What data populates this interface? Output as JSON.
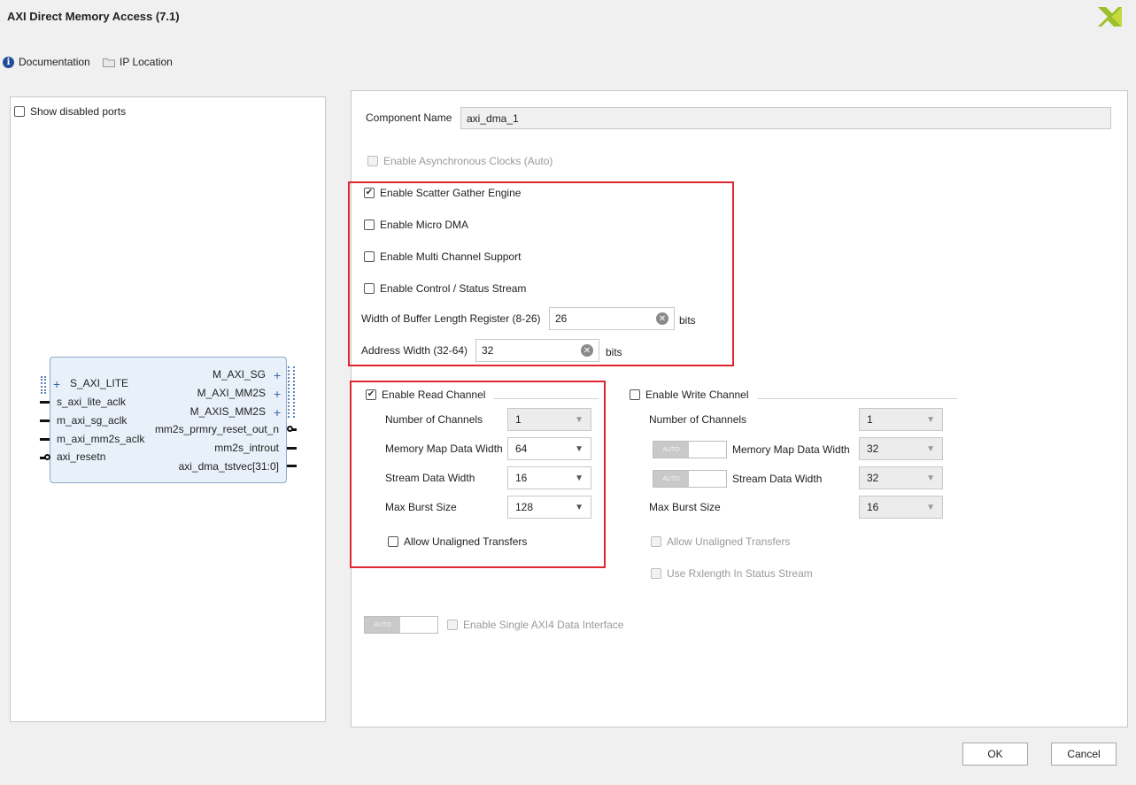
{
  "window": {
    "title": "AXI Direct Memory Access (7.1)"
  },
  "toolbar": {
    "documentation": "Documentation",
    "ip_location": "IP Location"
  },
  "left_panel": {
    "show_disabled_ports": "Show disabled ports",
    "ports_left": [
      "S_AXI_LITE",
      "s_axi_lite_aclk",
      "m_axi_sg_aclk",
      "m_axi_mm2s_aclk",
      "axi_resetn"
    ],
    "ports_right": [
      "M_AXI_SG",
      "M_AXI_MM2S",
      "M_AXIS_MM2S",
      "mm2s_prmry_reset_out_n",
      "mm2s_introut",
      "axi_dma_tstvec[31:0]"
    ]
  },
  "config": {
    "component_name_label": "Component Name",
    "component_name_value": "axi_dma_1",
    "enable_async_clocks": "Enable Asynchronous Clocks (Auto)",
    "enable_sg": "Enable Scatter Gather Engine",
    "enable_micro_dma": "Enable Micro DMA",
    "enable_multi_channel": "Enable Multi Channel Support",
    "enable_control_status": "Enable Control / Status Stream",
    "buffer_length_label": "Width of Buffer Length Register (8-26)",
    "buffer_length_value": "26",
    "address_width_label": "Address Width (32-64)",
    "address_width_value": "32",
    "bits": "bits"
  },
  "read_channel": {
    "title": "Enable Read Channel",
    "num_channels_label": "Number of Channels",
    "num_channels": "1",
    "mm_data_width_label": "Memory Map Data Width",
    "mm_data_width": "64",
    "stream_data_width_label": "Stream Data Width",
    "stream_data_width": "16",
    "max_burst_label": "Max Burst Size",
    "max_burst": "128",
    "allow_unaligned": "Allow Unaligned Transfers"
  },
  "write_channel": {
    "title": "Enable Write Channel",
    "num_channels_label": "Number of Channels",
    "num_channels": "1",
    "mm_data_width_label": "Memory Map Data Width",
    "mm_data_width": "32",
    "stream_data_width_label": "Stream Data Width",
    "stream_data_width": "32",
    "max_burst_label": "Max Burst Size",
    "max_burst": "16",
    "allow_unaligned": "Allow Unaligned Transfers",
    "use_rxlength": "Use Rxlength In Status Stream"
  },
  "auto_toggle_label": "AUTO",
  "single_axi4": "Enable Single AXI4 Data Interface",
  "buttons": {
    "ok": "OK",
    "cancel": "Cancel"
  },
  "colors": {
    "highlight_box": "#e0262e",
    "logo_green": "#9bbf2b"
  }
}
